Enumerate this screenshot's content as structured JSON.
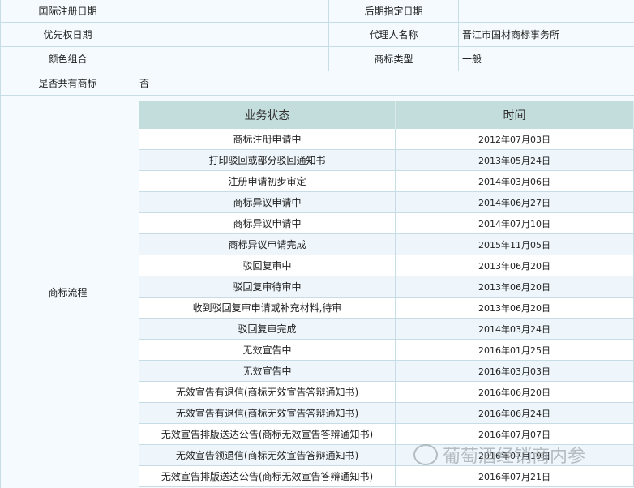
{
  "info_rows": [
    {
      "label1": "国际注册日期",
      "value1": "",
      "label2": "后期指定日期",
      "value2": ""
    },
    {
      "label1": "优先权日期",
      "value1": "",
      "label2": "代理人名称",
      "value2": "晋江市国材商标事务所"
    },
    {
      "label1": "颜色组合",
      "value1": "",
      "label2": "商标类型",
      "value2": "一般"
    }
  ],
  "shared": {
    "label": "是否共有商标",
    "value": "否"
  },
  "flow": {
    "label": "商标流程",
    "headers": {
      "status": "业务状态",
      "time": "时间"
    },
    "rows": [
      {
        "status": "商标注册申请中",
        "time": "2012年07月03日"
      },
      {
        "status": "打印驳回或部分驳回通知书",
        "time": "2013年05月24日"
      },
      {
        "status": "注册申请初步审定",
        "time": "2014年03月06日"
      },
      {
        "status": "商标异议申请中",
        "time": "2014年06月27日"
      },
      {
        "status": "商标异议申请中",
        "time": "2014年07月10日"
      },
      {
        "status": "商标异议申请完成",
        "time": "2015年11月05日"
      },
      {
        "status": "驳回复审中",
        "time": "2013年06月20日"
      },
      {
        "status": "驳回复审待审中",
        "time": "2013年06月20日"
      },
      {
        "status": "收到驳回复审申请或补充材料,待审",
        "time": "2013年06月20日"
      },
      {
        "status": "驳回复审完成",
        "time": "2014年03月24日"
      },
      {
        "status": "无效宣告中",
        "time": "2016年01月25日"
      },
      {
        "status": "无效宣告中",
        "time": "2016年03月03日"
      },
      {
        "status": "无效宣告有退信(商标无效宣告答辩通知书)",
        "time": "2016年06月20日"
      },
      {
        "status": "无效宣告有退信(商标无效宣告答辩通知书)",
        "time": "2016年06月24日"
      },
      {
        "status": "无效宣告排版送达公告(商标无效宣告答辩通知书)",
        "time": "2016年07月07日"
      },
      {
        "status": "无效宣告领退信(商标无效宣告答辩通知书)",
        "time": "2016年07月19日"
      },
      {
        "status": "无效宣告排版送达公告(商标无效宣告答辩通知书)",
        "time": "2016年07月21日"
      }
    ]
  },
  "watermark": "葡萄酒经销商内参"
}
